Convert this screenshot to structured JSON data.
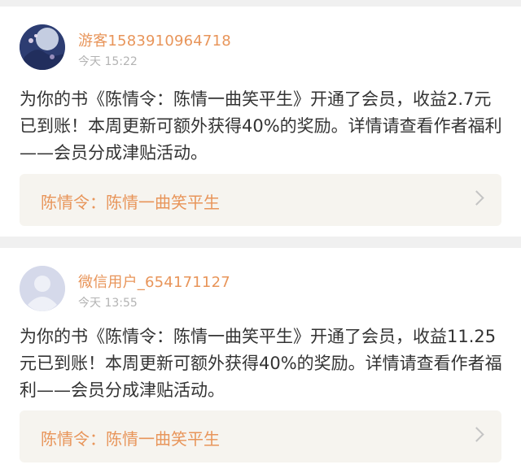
{
  "notifications": [
    {
      "username": "游客1583910964718",
      "time": "今天 15:22",
      "message": "为你的书《陈情令：陈情一曲笑平生》开通了会员，收益2.7元已到账！本周更新可额外获得40%的奖励。详情请查看作者福利——会员分成津贴活动。",
      "book_title": "陈情令：陈情一曲笑平生",
      "avatar_icon": "user-photo-avatar"
    },
    {
      "username": "微信用户_654171127",
      "time": "今天 13:55",
      "message": "为你的书《陈情令：陈情一曲笑平生》开通了会员，收益11.25元已到账！本周更新可额外获得40%的奖励。详情请查看作者福利——会员分成津贴活动。",
      "book_title": "陈情令：陈情一曲笑平生",
      "avatar_icon": "default-avatar-icon"
    }
  ],
  "colors": {
    "accent": "#e8955a",
    "text": "#333333",
    "muted": "#b3b3b3",
    "link_bg": "#f6f4ef",
    "page_bg": "#f0f0f0"
  }
}
